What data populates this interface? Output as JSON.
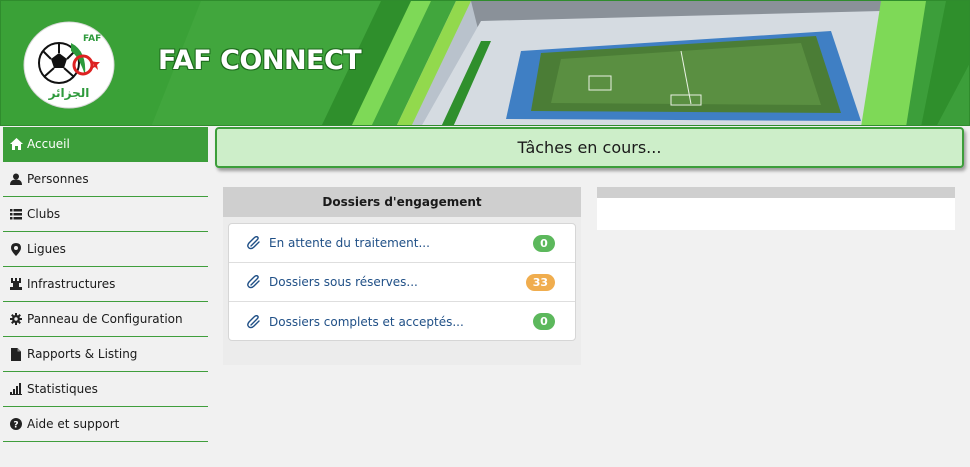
{
  "header": {
    "title": "FAF CONNECT",
    "logo_text": "الجزائر",
    "logo_mark": "FAF"
  },
  "sidebar": {
    "items": [
      {
        "label": "Accueil",
        "icon": "home-icon",
        "active": true
      },
      {
        "label": "Personnes",
        "icon": "user-icon",
        "active": false
      },
      {
        "label": "Clubs",
        "icon": "list-icon",
        "active": false
      },
      {
        "label": "Ligues",
        "icon": "map-marker-icon",
        "active": false
      },
      {
        "label": "Infrastructures",
        "icon": "tower-icon",
        "active": false
      },
      {
        "label": "Panneau de Configuration",
        "icon": "cog-icon",
        "active": false
      },
      {
        "label": "Rapports & Listing",
        "icon": "file-icon",
        "active": false
      },
      {
        "label": "Statistiques",
        "icon": "stats-icon",
        "active": false
      },
      {
        "label": "Aide et support",
        "icon": "question-icon",
        "active": false
      }
    ]
  },
  "main": {
    "task_title": "Tâches en cours...",
    "dossiers": {
      "title": "Dossiers d'engagement",
      "items": [
        {
          "label": "En attente du traitement...",
          "count": "0",
          "badge_color": "#5cb85c"
        },
        {
          "label": "Dossiers sous réserves...",
          "count": "33",
          "badge_color": "#f0ad4e"
        },
        {
          "label": "Dossiers complets et acceptés...",
          "count": "0",
          "badge_color": "#5cb85c"
        }
      ]
    }
  },
  "colors": {
    "brand_green": "#3c9e3a",
    "task_bg": "#cdeec9",
    "link": "#1f4f86"
  }
}
